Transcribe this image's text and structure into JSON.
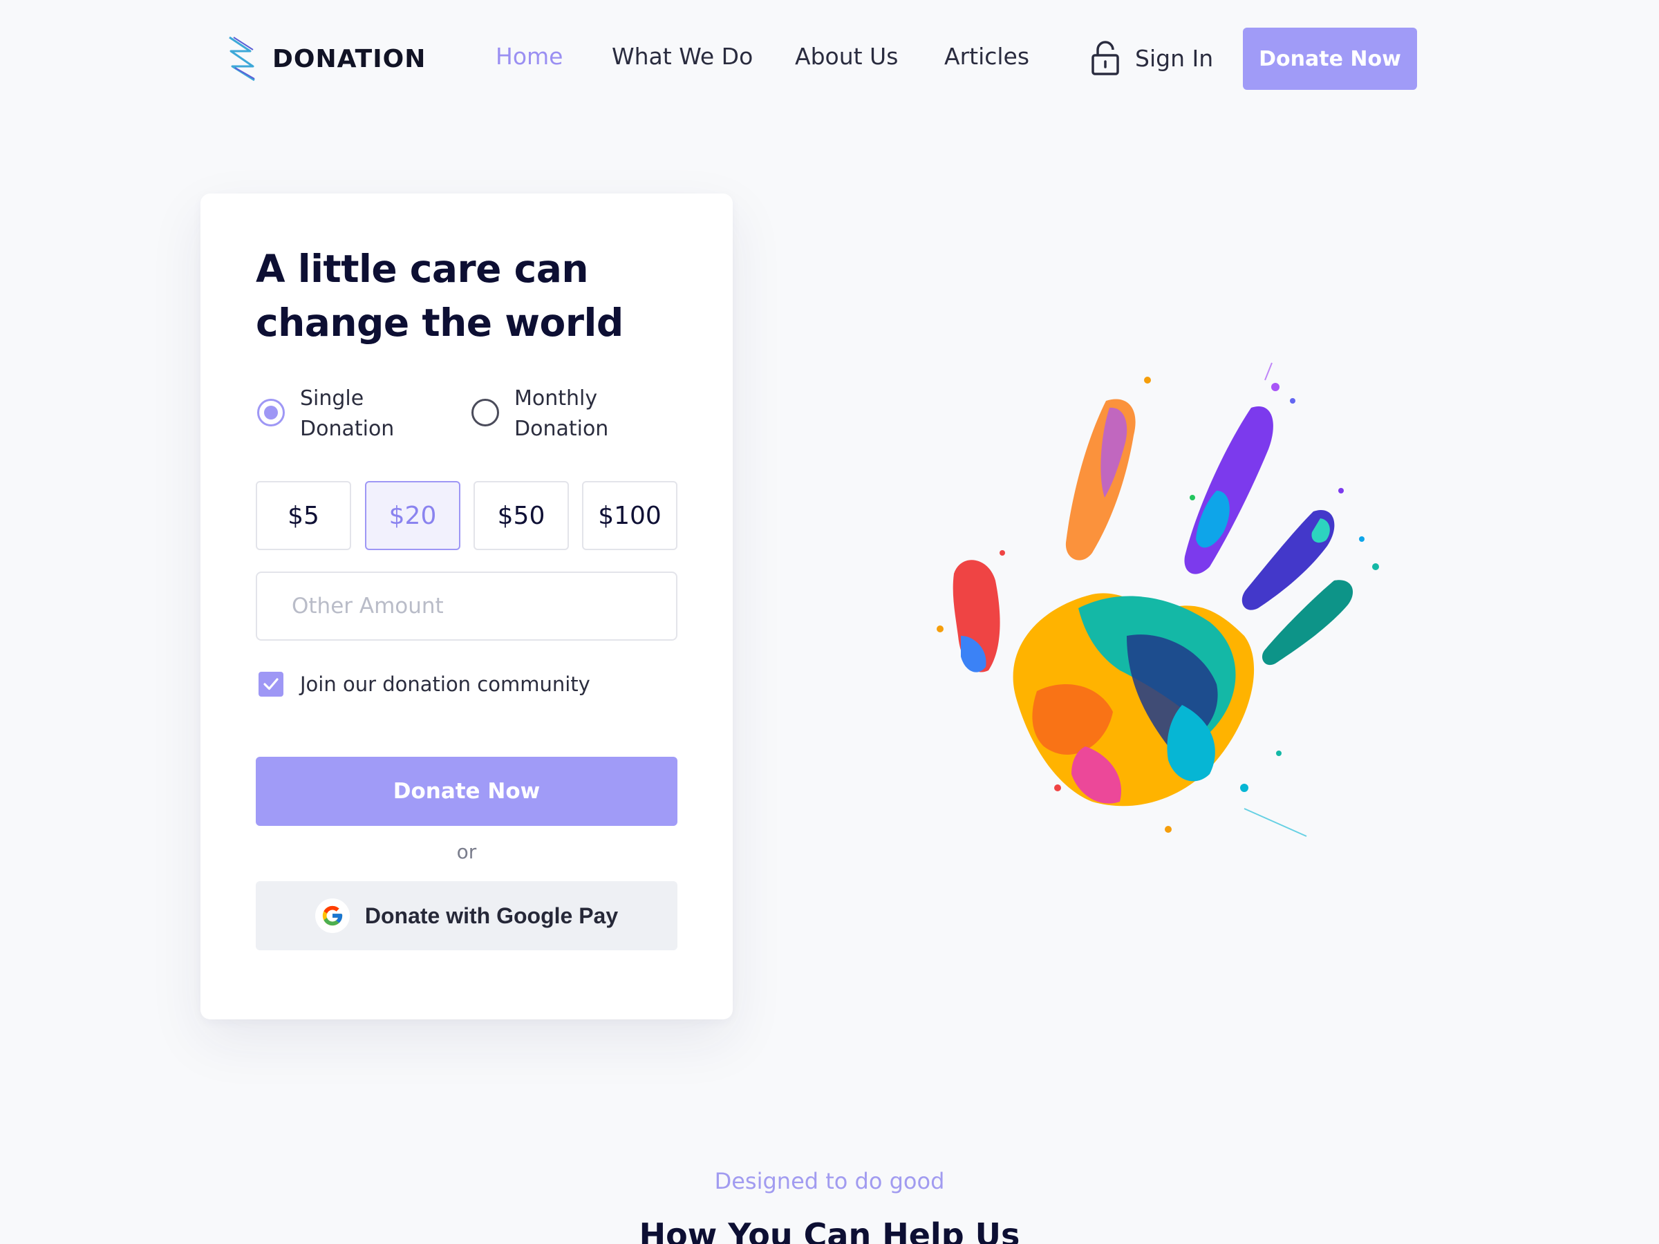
{
  "brand": {
    "name": "DONATION"
  },
  "nav": {
    "items": [
      {
        "label": "Home",
        "active": true
      },
      {
        "label": "What We Do",
        "active": false
      },
      {
        "label": "About Us",
        "active": false
      },
      {
        "label": "Articles",
        "active": false
      }
    ],
    "sign_in_label": "Sign In",
    "sign_in_icon": "lock-icon",
    "cta_label": "Donate Now"
  },
  "card": {
    "headline_line1": "A little care can",
    "headline_line2": "change the world",
    "frequency_options": [
      {
        "line1": "Single",
        "line2": "Donation",
        "selected": true
      },
      {
        "line1": "Monthly",
        "line2": "Donation",
        "selected": false
      }
    ],
    "amounts": [
      {
        "label": "$5",
        "selected": false
      },
      {
        "label": "$20",
        "selected": true
      },
      {
        "label": "$50",
        "selected": false
      },
      {
        "label": "$100",
        "selected": false
      }
    ],
    "other_amount_placeholder": "Other Amount",
    "other_amount_value": "",
    "community_label": "Join our donation community",
    "community_checked": true,
    "donate_label": "Donate Now",
    "or_label": "or",
    "google_pay_label": "Donate with Google Pay"
  },
  "section": {
    "eyebrow": "Designed to do good",
    "title": "How You Can Help Us"
  },
  "colors": {
    "accent": "#a09bf7",
    "accent_text": "#9a8ff2",
    "heading": "#0d0f33",
    "background": "#f8f9fb"
  }
}
